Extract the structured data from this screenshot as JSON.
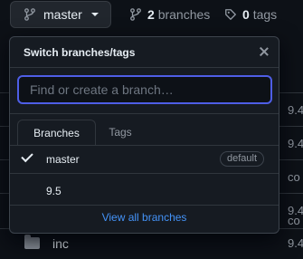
{
  "topbar": {
    "current_branch": "master",
    "branches_count": "2",
    "branches_label": "branches",
    "tags_count": "0",
    "tags_label": "tags"
  },
  "background_rows": [
    {
      "text": "9.4"
    },
    {
      "text": "9.4"
    },
    {
      "text": "co"
    },
    {
      "text": "9.4"
    },
    {
      "text": "co"
    }
  ],
  "background_folder": {
    "name": "inc",
    "right_text": "9.4"
  },
  "dropdown": {
    "title": "Switch branches/tags",
    "search_placeholder": "Find or create a branch…",
    "search_value": "",
    "tabs": [
      {
        "label": "Branches",
        "selected": true
      },
      {
        "label": "Tags",
        "selected": false
      }
    ],
    "items": [
      {
        "name": "master",
        "checked": true,
        "badge": "default"
      },
      {
        "name": "9.5",
        "checked": false,
        "badge": ""
      }
    ],
    "view_all_label": "View all branches"
  },
  "colors": {
    "background": "#0d1117",
    "panel": "#161b22",
    "border": "#30363d",
    "focus_ring": "#4e5ee6",
    "link": "#4493f8",
    "muted": "#9198a1"
  }
}
